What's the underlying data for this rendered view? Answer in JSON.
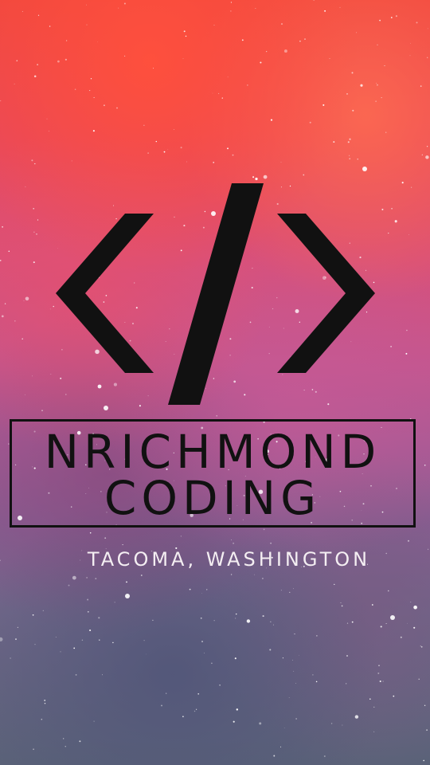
{
  "brand": {
    "symbol": "</>",
    "name_line1": "NRICHMOND",
    "name_line2": "CODING",
    "location": "TACOMA, WASHINGTON"
  },
  "colors": {
    "ink": "#111111",
    "location_text": "#f4eef2",
    "background_top": "#f0473f",
    "background_middle": "#c2568f",
    "background_bottom": "#5a6278"
  },
  "icons": {
    "logo": "code-brackets-slash-icon",
    "background": "starfield-nebula"
  }
}
